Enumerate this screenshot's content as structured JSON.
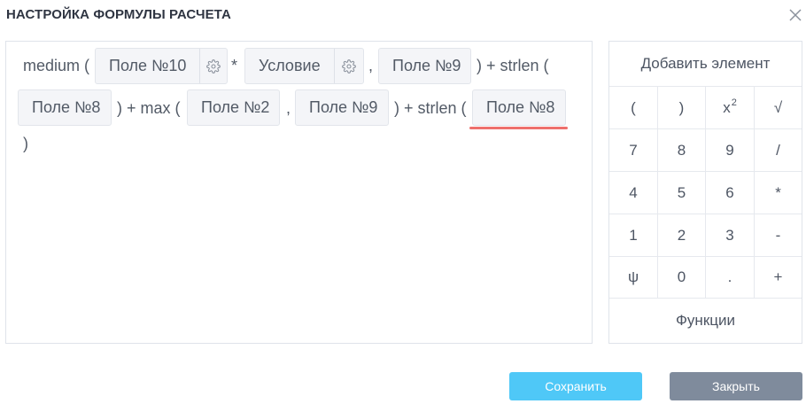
{
  "dialog": {
    "title": "НАСТРОЙКА ФОРМУЛЫ РАСЧЕТА"
  },
  "formula": {
    "tokens": [
      {
        "kind": "text",
        "text": "medium ("
      },
      {
        "kind": "chip",
        "text": "Поле №10",
        "gear": true
      },
      {
        "kind": "text",
        "text": "*"
      },
      {
        "kind": "chip",
        "text": "Условие",
        "gear": true
      },
      {
        "kind": "text",
        "text": ","
      },
      {
        "kind": "chip",
        "text": "Поле №9"
      },
      {
        "kind": "text",
        "text": ") + strlen ("
      },
      {
        "kind": "chip",
        "text": "Поле №8"
      },
      {
        "kind": "text",
        "text": ") + max ("
      },
      {
        "kind": "chip",
        "text": "Поле №2"
      },
      {
        "kind": "text",
        "text": ","
      },
      {
        "kind": "chip",
        "text": "Поле №9"
      },
      {
        "kind": "text",
        "text": ") + strlen ("
      },
      {
        "kind": "chip",
        "text": "Поле №8",
        "selected": true
      },
      {
        "kind": "text",
        "text": ")"
      }
    ]
  },
  "keypad": {
    "header": "Добавить элемент",
    "rows": [
      [
        "(",
        ")",
        "x",
        "√"
      ],
      [
        "7",
        "8",
        "9",
        "/"
      ],
      [
        "4",
        "5",
        "6",
        "*"
      ],
      [
        "1",
        "2",
        "3",
        "-"
      ],
      [
        "ψ",
        "0",
        ".",
        "+"
      ]
    ],
    "power_superscript": "2",
    "footer": "Функции"
  },
  "buttons": {
    "save": "Сохранить",
    "close": "Закрыть"
  },
  "colors": {
    "save_button": "#4fc8f7",
    "close_button": "#7f8b9c",
    "selection_underline": "#ee6f6c",
    "chip_background": "#f4f5f8"
  }
}
